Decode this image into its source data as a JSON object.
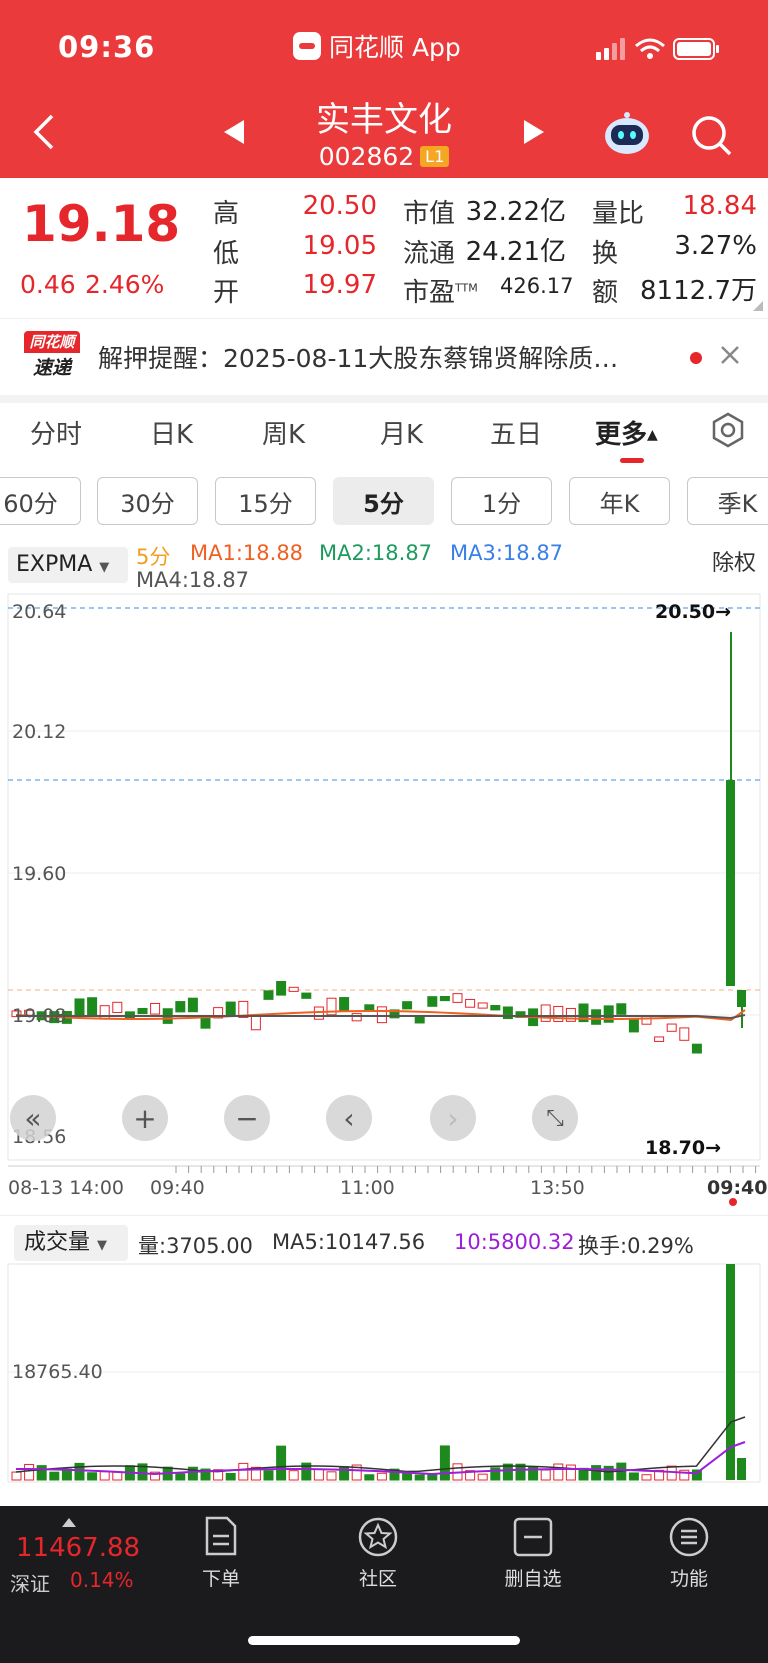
{
  "status": {
    "time": "09:36",
    "app": "同花顺 App"
  },
  "header": {
    "name": "实丰文化",
    "code": "002862",
    "level": "L1"
  },
  "quote": {
    "price": "19.18",
    "change": "0.46",
    "pct": "2.46%",
    "rows": [
      {
        "l1": "高",
        "v1": "20.50",
        "l2": "市值",
        "v2": "32.22亿",
        "l3": "量比",
        "v3": "18.84"
      },
      {
        "l1": "低",
        "v1": "19.05",
        "l2": "流通",
        "v2": "24.21亿",
        "l3": "换",
        "v3": "3.27%"
      },
      {
        "l1": "开",
        "v1": "19.97",
        "l2": "市盈",
        "l2sup": "TTM",
        "v2": "426.17",
        "l3": "额",
        "v3": "8112.7万"
      }
    ]
  },
  "news": {
    "badge_top": "同花顺",
    "badge_bottom": "速递",
    "text": "解押提醒：2025-08-11大股东蔡锦贤解除质…"
  },
  "tabs": [
    "分时",
    "日K",
    "周K",
    "月K",
    "五日",
    "更多"
  ],
  "periods": [
    "60分",
    "30分",
    "15分",
    "5分",
    "1分",
    "年K",
    "季K"
  ],
  "selected_period": "5分",
  "indicator": {
    "name": "EXPMA",
    "period": "5分",
    "ma1": "MA1:18.88",
    "ma2": "MA2:18.87",
    "ma3": "MA3:18.87",
    "ma4": "MA4:18.87",
    "adjust": "除权"
  },
  "chart_data": {
    "type": "candlestick",
    "y_ticks": [
      "20.64",
      "20.12",
      "19.60",
      "19.08",
      "18.56"
    ],
    "high_mark": "20.50→",
    "low_mark": "18.70→",
    "x_ticks": [
      "08-13 14:00",
      "09:40",
      "11:00",
      "13:50",
      "09:40"
    ],
    "volume": {
      "indicator": "成交量",
      "vol": "量:3705.00",
      "ma5": "MA5:10147.56",
      "ma10": "10:5800.32",
      "turnover": "换手:0.29%",
      "y_tick": "18765.40"
    }
  },
  "market": {
    "value": "11467.88",
    "name": "深证",
    "pct": "0.14%"
  },
  "bottom_nav": [
    "下单",
    "社区",
    "删自选",
    "功能"
  ],
  "colors": {
    "header": "#ea3a3c",
    "up": "#e5262b",
    "down": "#1e8a1e"
  }
}
